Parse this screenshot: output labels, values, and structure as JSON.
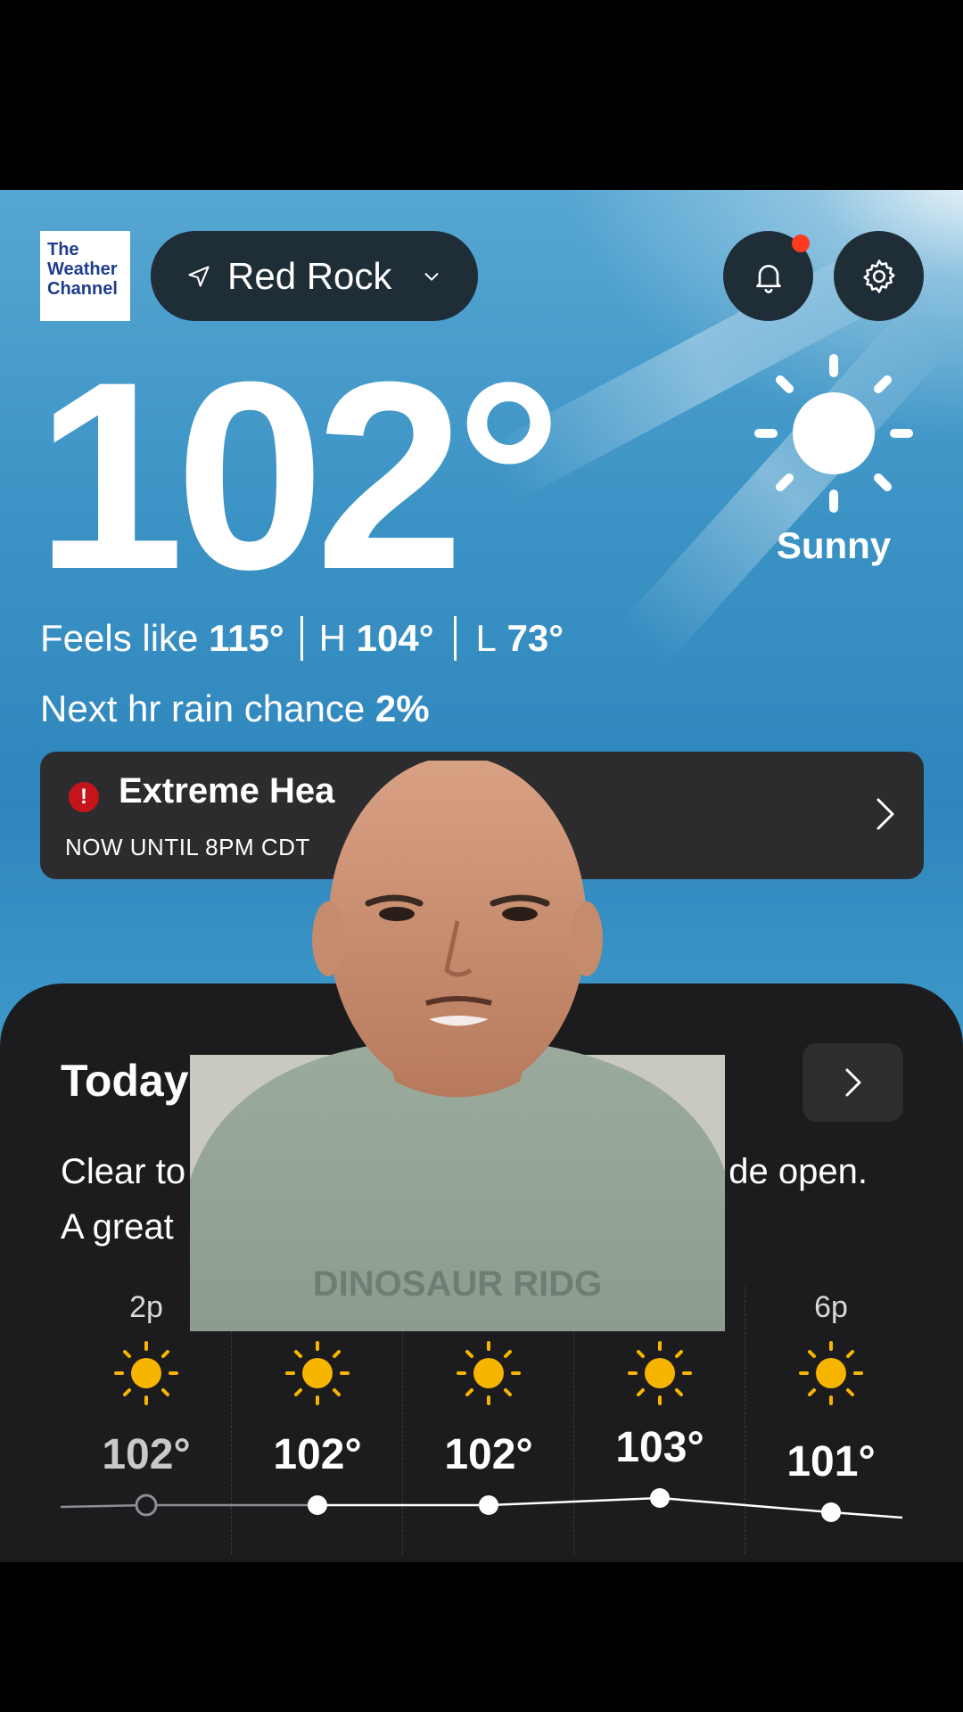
{
  "app": {
    "logo_lines": [
      "The",
      "Weather",
      "Channel"
    ],
    "location": "Red Rock",
    "notification_badge": true
  },
  "current": {
    "temperature": "102°",
    "condition": "Sunny",
    "feels_like_label": "Feels like",
    "feels_like": "115°",
    "high_label": "H",
    "high": "104°",
    "low_label": "L",
    "low": "73°",
    "rain_label": "Next hr rain chance",
    "rain_chance": "2%"
  },
  "alert": {
    "title": "Extreme Hea",
    "time": "NOW UNTIL 8PM CDT",
    "icon": "exclamation-icon"
  },
  "today": {
    "title": "Today",
    "description_line1": "Clear to",
    "description_line1_end": "de open.",
    "description_line2": "A great",
    "hourly": [
      {
        "time": "2p",
        "temp": "102°",
        "value": 102,
        "past": true
      },
      {
        "time": "",
        "temp": "102°",
        "value": 102,
        "past": false
      },
      {
        "time": "",
        "temp": "102°",
        "value": 102,
        "past": false
      },
      {
        "time": "",
        "temp": "103°",
        "value": 103,
        "past": false
      },
      {
        "time": "6p",
        "temp": "101°",
        "value": 101,
        "past": false
      }
    ]
  },
  "overlay": {
    "shirt_text": "DINOSAUR RIDG"
  },
  "colors": {
    "panel": "#1c1c1e",
    "pill": "#1f2d37",
    "alert_red": "#c5141b",
    "sun_yellow": "#f7b500"
  }
}
